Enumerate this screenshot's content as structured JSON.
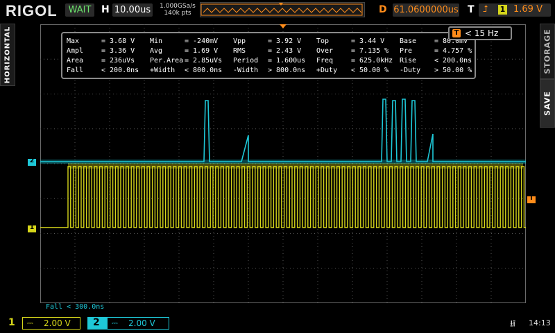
{
  "header": {
    "logo": "RIGOL",
    "run_status": "WAIT",
    "timebase_label": "H",
    "timebase_value": "10.00us",
    "sample_rate": "1.000GSa/s",
    "memory_depth": "140k pts",
    "delay_label": "D",
    "delay_value": "61.0600000us",
    "trigger_label": "T",
    "trigger_source": "1",
    "trigger_level": "1.69 V"
  },
  "side_tabs": {
    "left": "HORIZONTAL",
    "right_top": "STORAGE",
    "right_bottom": "SAVE"
  },
  "measurements": {
    "rows": [
      [
        [
          "Max",
          "= 3.68 V"
        ],
        [
          "Min",
          "= -240mV"
        ],
        [
          "Vpp",
          "= 3.92 V"
        ],
        [
          "Top",
          "= 3.44 V"
        ],
        [
          "Base",
          "= 80.0mV"
        ]
      ],
      [
        [
          "Ampl",
          "= 3.36 V"
        ],
        [
          "Avg",
          "= 1.69 V"
        ],
        [
          "RMS",
          "= 2.43 V"
        ],
        [
          "Over",
          "= 7.135 %"
        ],
        [
          "Pre",
          "= 4.757 %"
        ]
      ],
      [
        [
          "Area",
          "= 236uVs"
        ],
        [
          "Per.Area",
          "= 2.85uVs"
        ],
        [
          "Period",
          "= 1.600us"
        ],
        [
          "Freq",
          "= 625.0kHz"
        ],
        [
          "Rise",
          "< 200.0ns"
        ]
      ],
      [
        [
          "Fall",
          "< 200.0ns"
        ],
        [
          "+Width",
          "< 800.0ns"
        ],
        [
          "-Width",
          "> 800.0ns"
        ],
        [
          "+Duty",
          "< 50.00 %"
        ],
        [
          "-Duty",
          "> 50.00 %"
        ]
      ]
    ]
  },
  "counter": {
    "icon": "T",
    "value": "< 15 Hz"
  },
  "markers": {
    "ch1": "1",
    "ch2": "2",
    "trigger": "T"
  },
  "footer_measure": "Fall < 300.0ns",
  "channels": [
    {
      "num": "1",
      "coupling": "DC",
      "scale": "2.00 V",
      "color": "#d6d61a"
    },
    {
      "num": "2",
      "coupling": "DC",
      "scale": "2.00 V",
      "color": "#1ec8d8"
    }
  ],
  "clock": "14:13",
  "colors": {
    "ch1": "#d6d61a",
    "ch2": "#1ec8d8",
    "trigger": "#ff8c1a",
    "status": "#6be36b"
  }
}
